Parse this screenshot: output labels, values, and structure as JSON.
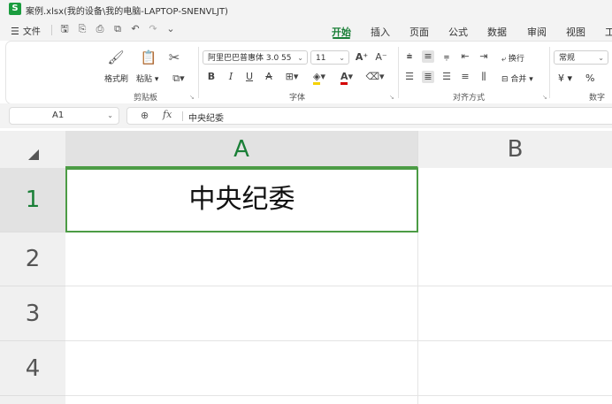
{
  "title_bar": {
    "logo": "S",
    "title": "案例.xlsx(我的设备\\我的电脑-LAPTOP-SNENVLJT)"
  },
  "menu": {
    "file": "文件",
    "quick_icons": [
      "save-icon",
      "export-icon",
      "print-icon",
      "print-preview-icon",
      "undo-icon",
      "redo-icon",
      "more-icon"
    ],
    "tabs": [
      {
        "label": "开始",
        "active": true
      },
      {
        "label": "插入"
      },
      {
        "label": "页面"
      },
      {
        "label": "公式"
      },
      {
        "label": "数据"
      },
      {
        "label": "审阅"
      },
      {
        "label": "视图"
      },
      {
        "label": "工"
      }
    ]
  },
  "ribbon": {
    "clipboard": {
      "format_painter": "格式刷",
      "paste": "粘贴",
      "group_label": "剪贴板"
    },
    "font": {
      "family": "阿里巴巴普惠体 3.0 55",
      "size": "11",
      "bold": "B",
      "italic": "I",
      "underline": "U",
      "strike": "A",
      "increase": "A⁺",
      "decrease": "A⁻",
      "font_color_letter": "A",
      "group_label": "字体"
    },
    "alignment": {
      "wrap": "换行",
      "merge": "合并",
      "group_label": "对齐方式"
    },
    "number": {
      "format": "常规",
      "currency": "¥",
      "percent": "%",
      "group_label": "数字格"
    },
    "colors": {
      "accent": "#1a7f37",
      "fill_yellow": "#f5d200",
      "font_red": "#d40000"
    }
  },
  "formula_bar": {
    "name_box": "A1",
    "fx": "fx",
    "value": "中央纪委"
  },
  "sheet": {
    "columns": [
      "A",
      "B"
    ],
    "rows": [
      "1",
      "2",
      "3",
      "4"
    ],
    "selected_cell": "A1",
    "cells": {
      "A1": "中央纪委"
    },
    "selection_color": "#4c9c45"
  }
}
